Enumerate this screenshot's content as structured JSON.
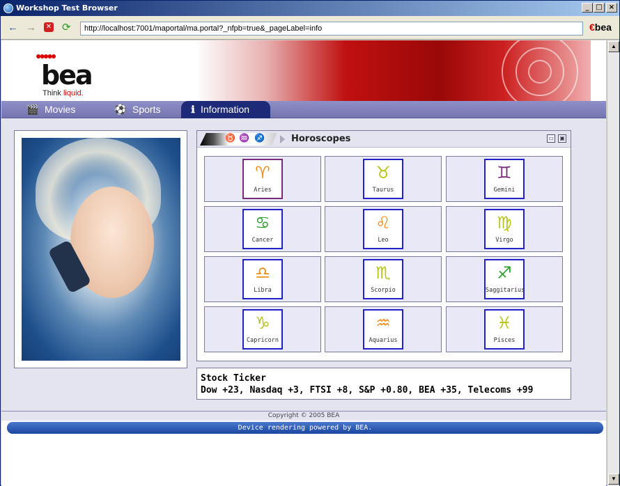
{
  "window": {
    "title": "Workshop Test Browser",
    "min_label": "_",
    "max_label": "□",
    "close_label": "×"
  },
  "toolbar": {
    "back_icon": "←",
    "forward_icon": "→",
    "stop_icon": "✕",
    "refresh_icon": "⟳",
    "address": "http://localhost:7001/maportal/ma.portal?_nfpb=true&_pageLabel=info",
    "brand_e": "€",
    "brand": "bea"
  },
  "header": {
    "logo_dots": "●●●●●",
    "logo_word": "bea",
    "tagline_a": "Think ",
    "tagline_b": "liquid."
  },
  "menu": {
    "tabs": [
      {
        "label": "Movies",
        "icon": "🎬"
      },
      {
        "label": "Sports",
        "icon": "⚽"
      },
      {
        "label": "Information",
        "icon": "ℹ"
      }
    ],
    "active": "Information"
  },
  "horoscopes": {
    "title": "Horoscopes",
    "deco_glyphs": [
      "♉",
      "♒",
      "♐"
    ],
    "minimize": "▭",
    "maximize": "▣",
    "signs": [
      {
        "name": "Aries",
        "glyph": "♈",
        "color": "#f28c1a"
      },
      {
        "name": "Taurus",
        "glyph": "♉",
        "color": "#b8c418"
      },
      {
        "name": "Gemini",
        "glyph": "♊",
        "color": "#7a2a7a"
      },
      {
        "name": "Cancer",
        "glyph": "♋",
        "color": "#2ea02e"
      },
      {
        "name": "Leo",
        "glyph": "♌",
        "color": "#f28c1a"
      },
      {
        "name": "Virgo",
        "glyph": "♍",
        "color": "#b8c418"
      },
      {
        "name": "Libra",
        "glyph": "♎",
        "color": "#f28c1a"
      },
      {
        "name": "Scorpio",
        "glyph": "♏",
        "color": "#b8c418"
      },
      {
        "name": "Saggitarius",
        "glyph": "♐",
        "color": "#2ea02e"
      },
      {
        "name": "Capricorn",
        "glyph": "♑",
        "color": "#b8c418"
      },
      {
        "name": "Aquarius",
        "glyph": "♒",
        "color": "#f28c1a"
      },
      {
        "name": "Pisces",
        "glyph": "♓",
        "color": "#b8c418"
      }
    ]
  },
  "stock": {
    "title": "Stock Ticker",
    "text": "Dow +23, Nasdaq +3, FTSI +8, S&P +0.80, BEA +35, Telecoms +99"
  },
  "footer": {
    "copyright": "Copyright © 2005 BEA",
    "powered": "Device rendering powered by BEA."
  },
  "scroll": {
    "up": "▲",
    "down": "▼"
  }
}
